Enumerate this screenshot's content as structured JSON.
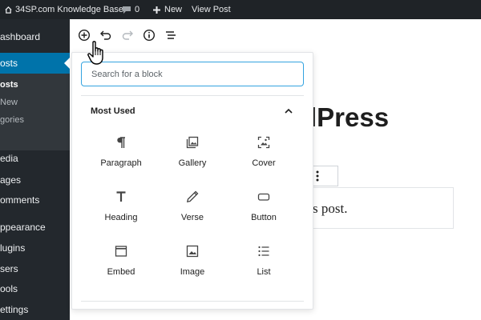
{
  "admin_bar": {
    "site_name": "34SP.com Knowledge Base",
    "comments_count": "0",
    "new_label": "New",
    "view_post_label": "View Post"
  },
  "sidebar": {
    "items": [
      {
        "label": "ashboard"
      },
      {
        "label": "osts",
        "active": true
      },
      {
        "label": "edia"
      },
      {
        "label": "ages"
      },
      {
        "label": "omments"
      },
      {
        "label": "ppearance"
      },
      {
        "label": "lugins"
      },
      {
        "label": "sers"
      },
      {
        "label": "ools"
      },
      {
        "label": "ettings"
      }
    ],
    "submenu": [
      "osts",
      "New",
      "gories"
    ]
  },
  "toolbar": {
    "icons": [
      "add-block-icon",
      "undo-icon",
      "redo-icon",
      "info-icon",
      "outline-icon"
    ]
  },
  "content": {
    "title_fragment": "lPress",
    "paragraph_fragment": "s post."
  },
  "inserter": {
    "search_placeholder": "Search for a block",
    "panel_title": "Most Used",
    "blocks": [
      {
        "label": "Paragraph",
        "icon": "paragraph-icon"
      },
      {
        "label": "Gallery",
        "icon": "gallery-icon"
      },
      {
        "label": "Cover",
        "icon": "cover-icon"
      },
      {
        "label": "Heading",
        "icon": "heading-icon"
      },
      {
        "label": "Verse",
        "icon": "verse-icon"
      },
      {
        "label": "Button",
        "icon": "button-icon"
      },
      {
        "label": "Embed",
        "icon": "embed-icon"
      },
      {
        "label": "Image",
        "icon": "image-icon"
      },
      {
        "label": "List",
        "icon": "list-icon"
      }
    ]
  },
  "colors": {
    "admin_bar_bg": "#1f2327",
    "sidebar_bg": "#23282d",
    "active_menu": "#0073aa",
    "search_border": "#33a3e0"
  }
}
